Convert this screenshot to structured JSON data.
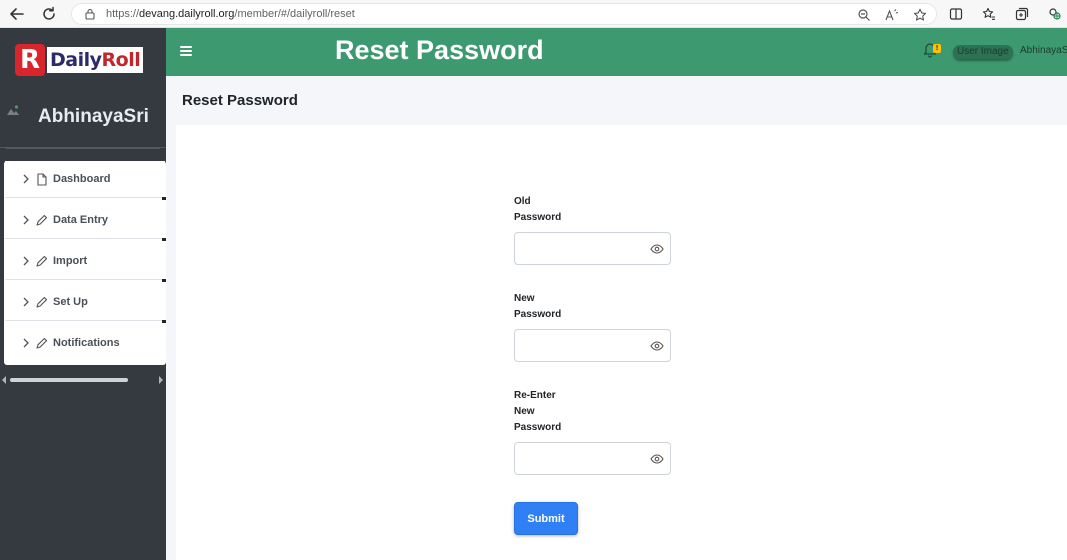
{
  "browser": {
    "url_prefix": "https://",
    "url_host": "devang.dailyroll.org",
    "url_path": "/member/#/dailyroll/reset"
  },
  "sidebar": {
    "logo_letter": "R",
    "logo_text_main": "Daily",
    "logo_text_accent": "Roll",
    "user_name": "AbhinayaSri",
    "items": [
      {
        "label": "Dashboard",
        "icon": "file-icon"
      },
      {
        "label": "Data Entry",
        "icon": "pencil-icon"
      },
      {
        "label": "Import",
        "icon": "pencil-icon"
      },
      {
        "label": "Set Up",
        "icon": "pencil-icon"
      },
      {
        "label": "Notifications",
        "icon": "pencil-icon"
      }
    ]
  },
  "header": {
    "title": "Reset Password",
    "notification_badge": "!",
    "user_image_alt": "User Image",
    "user_name": "AbhinayaS"
  },
  "content": {
    "page_heading": "Reset Password",
    "old_password_label": "Old Password",
    "new_password_label": "New Password",
    "reenter_password_label": "Re-Enter New Password",
    "old_password_value": "",
    "new_password_value": "",
    "reenter_password_value": "",
    "submit_label": "Submit"
  },
  "colors": {
    "header_bg": "#3d9970",
    "sidebar_bg": "#343a40",
    "primary_button": "#2f7ff5",
    "badge": "#ffc107"
  }
}
